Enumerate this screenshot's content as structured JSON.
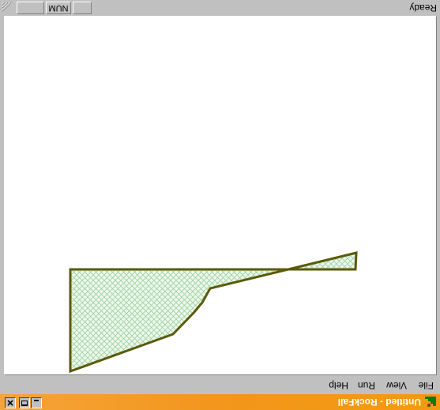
{
  "window": {
    "title": "Untitled - RockFall",
    "title_bar_color": "#f39a10",
    "app_icon": "rockfall-app-icon",
    "controls": {
      "minimize": "minimize-icon",
      "maximize": "maximize-icon",
      "close": "close-icon"
    }
  },
  "menu": {
    "file": "File",
    "view": "View",
    "run": "Run",
    "help": "Help"
  },
  "canvas": {
    "shape": "hatched-slope-profile-polygon",
    "outline_color": "#5b5a0a",
    "fill_color": "#e7f3e7",
    "hatch_color": "#8fd08f"
  },
  "status": {
    "text": "Ready",
    "num": "NUM",
    "caps": "",
    "scrl": ""
  }
}
